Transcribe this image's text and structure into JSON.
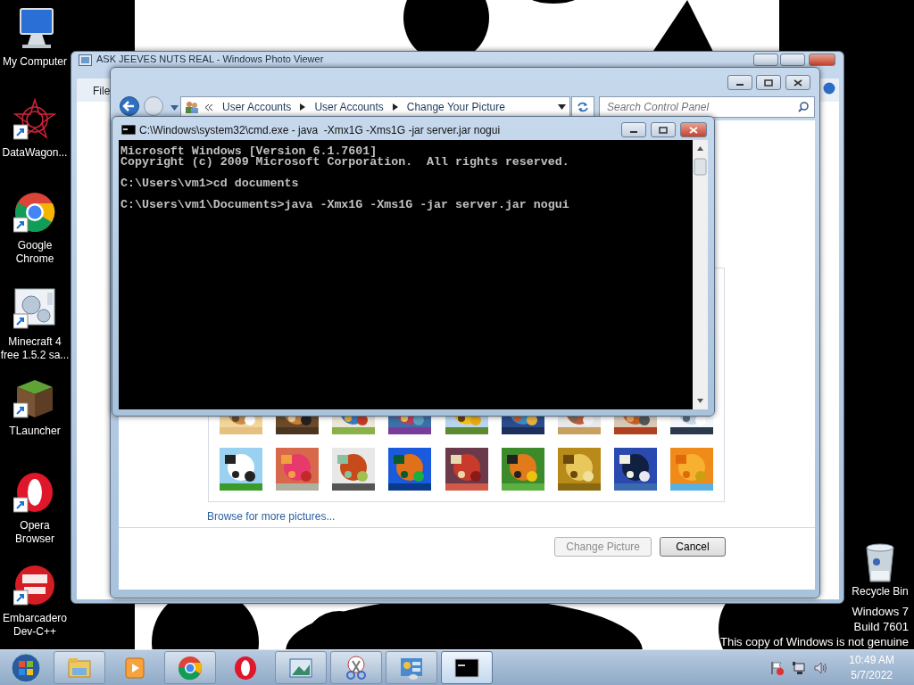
{
  "desktop_icons": [
    {
      "kind": "computer",
      "label": "My Computer",
      "shortcut": false
    },
    {
      "kind": "star",
      "label": "DataWagon...",
      "shortcut": true
    },
    {
      "kind": "chrome",
      "label": "Google Chrome",
      "shortcut": true
    },
    {
      "kind": "gears",
      "label": "Minecraft 4 free 1.5.2 sa...",
      "shortcut": true
    },
    {
      "kind": "block",
      "label": "TLauncher",
      "shortcut": true
    },
    {
      "kind": "opera",
      "label": "Opera Browser",
      "shortcut": true
    },
    {
      "kind": "dev",
      "label": "Embarcadero Dev-C++",
      "shortcut": true
    }
  ],
  "photo_viewer": {
    "title": "ASK JEEVES NUTS REAL - Windows Photo Viewer",
    "menu": [
      "File"
    ]
  },
  "control_panel": {
    "breadcrumb": [
      "User Accounts",
      "User Accounts",
      "Change Your Picture"
    ],
    "search": {
      "placeholder": "Search Control Panel"
    },
    "link": "Browse for more pictures...",
    "buttons": [
      {
        "label": "Change Picture",
        "disabled": true
      },
      {
        "label": "Cancel",
        "disabled": false
      }
    ]
  },
  "console": {
    "title": "C:\\Windows\\system32\\cmd.exe - java  -Xmx1G -Xms1G -jar server.jar nogui",
    "blocks": [
      [
        "Microsoft Windows [Version 6.1.7601]",
        "Copyright (c) 2009 Microsoft Corporation.  All rights reserved."
      ],
      [
        "C:\\Users\\vm1>cd documents"
      ],
      [
        "C:\\Users\\vm1\\Documents>java -Xmx1G -Xms1G -jar server.jar nogui"
      ]
    ]
  },
  "recycle_bin": {
    "label": "Recycle Bin"
  },
  "genuine_notice": [
    "Windows 7",
    "Build 7601",
    "This copy of Windows is not genuine"
  ],
  "taskbar": {
    "buttons": [
      {
        "kind": "folder",
        "running": true,
        "selected": false
      },
      {
        "kind": "media",
        "running": false,
        "selected": false
      },
      {
        "kind": "chrome",
        "running": true,
        "selected": false
      },
      {
        "kind": "opera",
        "running": false,
        "selected": false
      },
      {
        "kind": "photos",
        "running": true,
        "selected": false
      },
      {
        "kind": "scissors",
        "running": true,
        "selected": false
      },
      {
        "kind": "panel",
        "running": true,
        "selected": false
      },
      {
        "kind": "cmd",
        "running": true,
        "selected": true
      }
    ],
    "clock": {
      "time": "10:49 AM",
      "date": "5/7/2022"
    }
  }
}
